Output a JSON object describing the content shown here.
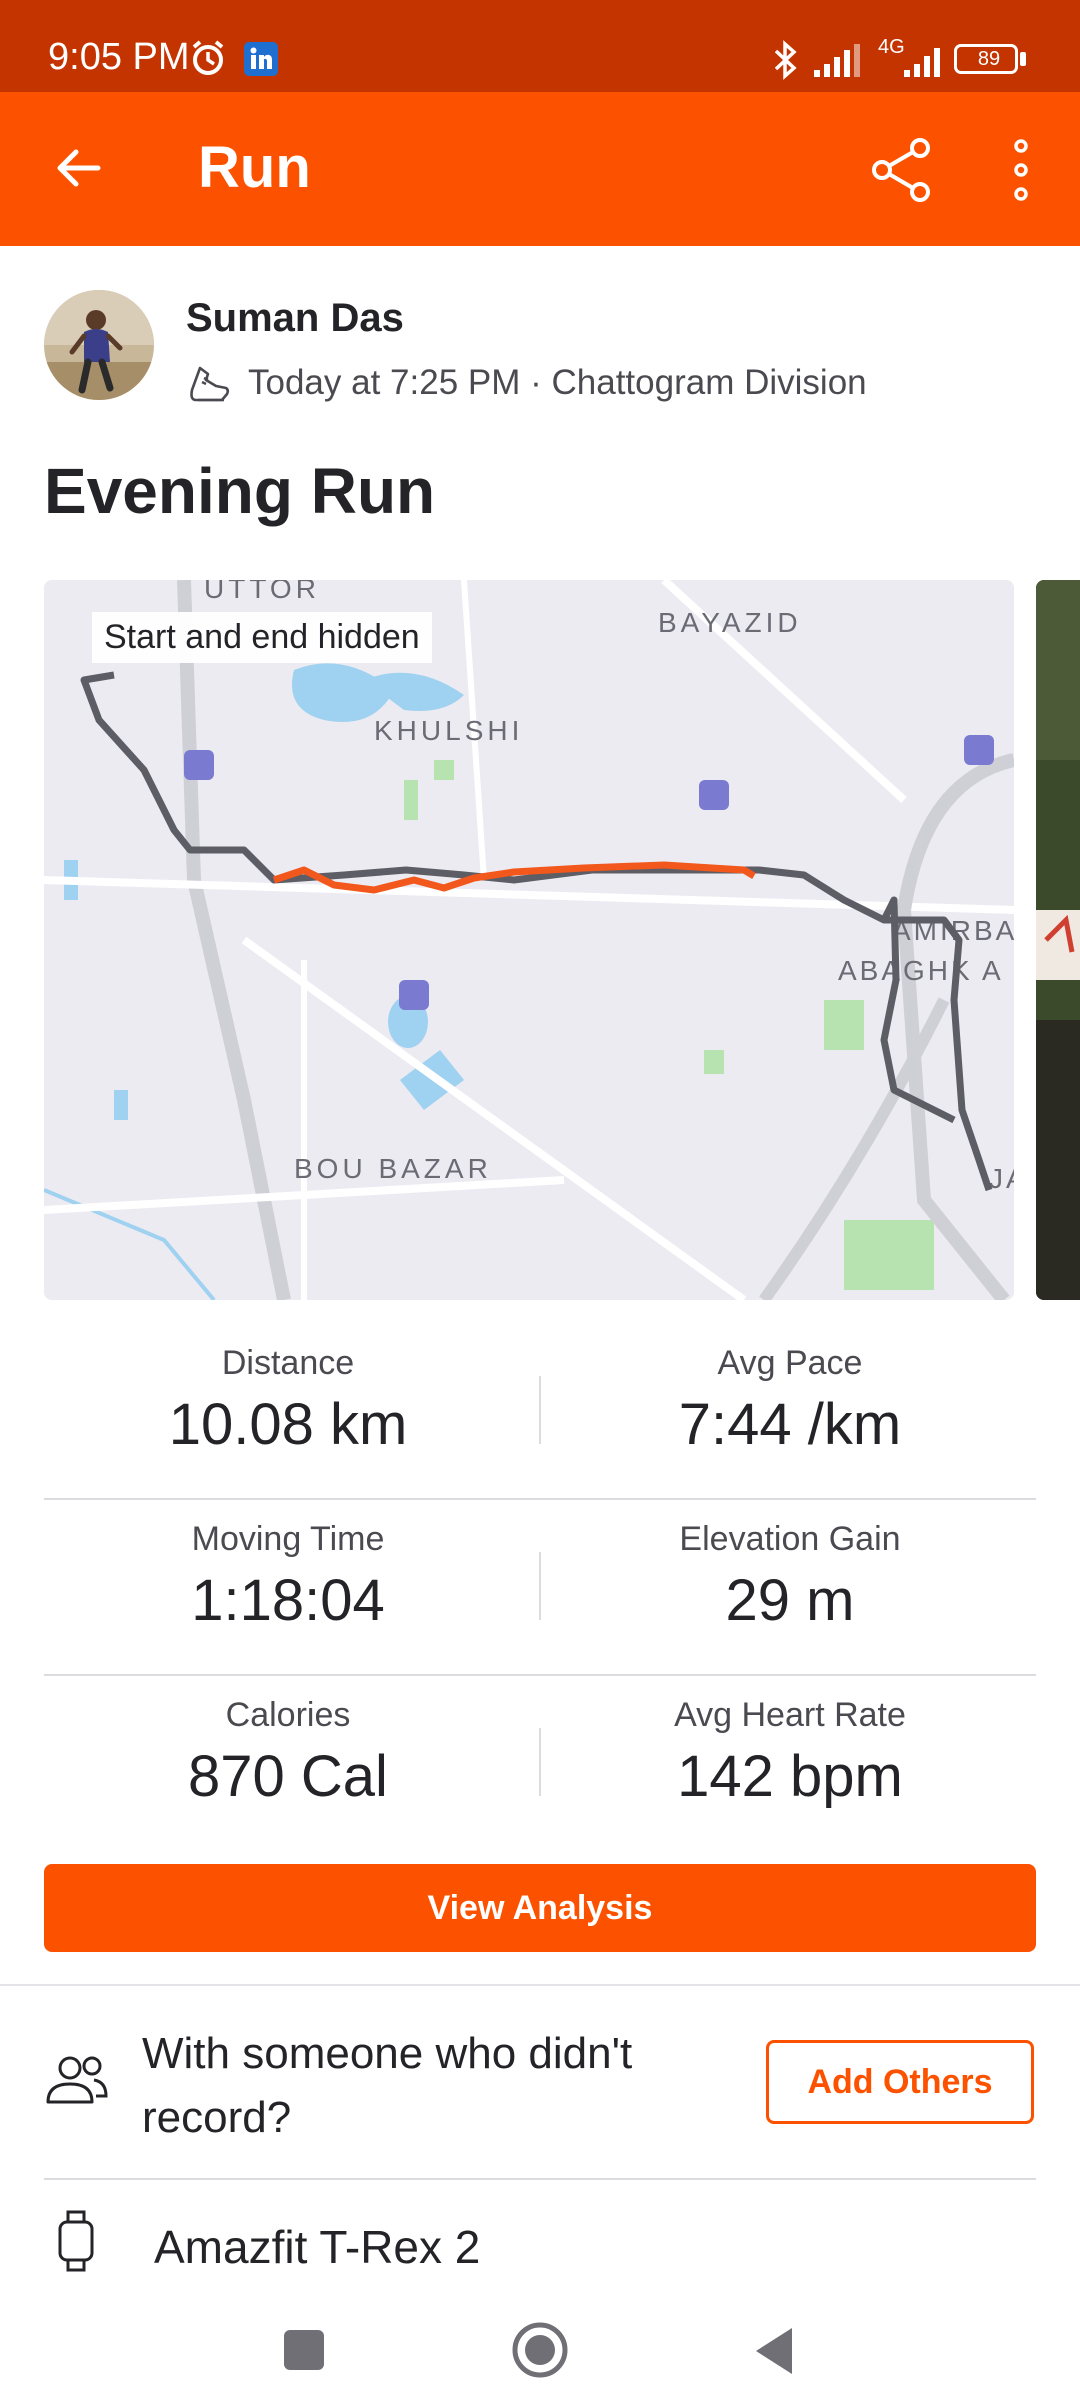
{
  "status_bar": {
    "time": "9:05 PM",
    "network": "4G",
    "battery": "89",
    "icons": [
      "alarm-icon",
      "linkedin-icon",
      "bluetooth-icon",
      "signal-icon",
      "battery-icon"
    ]
  },
  "app_bar": {
    "title": "Run",
    "icons": [
      "back-arrow-icon",
      "share-icon",
      "more-vertical-icon"
    ]
  },
  "athlete": {
    "name": "Suman Das",
    "date_text": "Today at 7:25 PM",
    "location": "Chattogram Division",
    "separator": " · "
  },
  "activity": {
    "title": "Evening Run"
  },
  "map": {
    "privacy_label": "Start and end hidden",
    "place_labels": [
      "UTTOR",
      "BAYAZID",
      "KHULSHI",
      "AMIRBA",
      "ABAGHK A",
      "BOU BAZAR",
      "JA"
    ]
  },
  "stats": [
    {
      "label": "Distance",
      "value": "10.08 km"
    },
    {
      "label": "Avg Pace",
      "value": "7:44 /km"
    },
    {
      "label": "Moving Time",
      "value": "1:18:04"
    },
    {
      "label": "Elevation Gain",
      "value": "29 m"
    },
    {
      "label": "Calories",
      "value": "870 Cal"
    },
    {
      "label": "Avg Heart Rate",
      "value": "142 bpm"
    }
  ],
  "buttons": {
    "view_analysis": "View Analysis",
    "add_others": "Add Others"
  },
  "group_prompt": "With someone who didn't record?",
  "device": {
    "name": "Amazfit T-Rex 2"
  },
  "colors": {
    "brand": "#fc5200",
    "status_bar": "#c33400",
    "route_highlight": "#f2571b",
    "route": "#5d5d66"
  }
}
